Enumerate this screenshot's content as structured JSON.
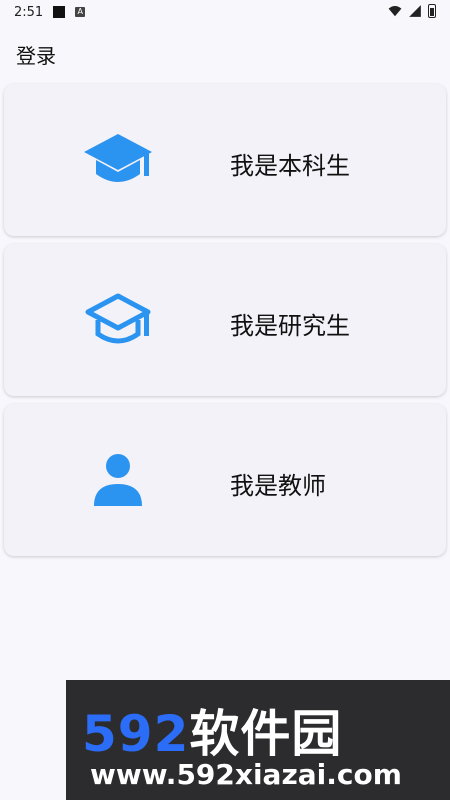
{
  "status_bar": {
    "time": "2:51",
    "a_glyph": "A"
  },
  "header": {
    "title": "登录"
  },
  "cards": [
    {
      "label": "我是本科生",
      "icon": "graduation-cap-filled-icon"
    },
    {
      "label": "我是研究生",
      "icon": "graduation-cap-outline-icon"
    },
    {
      "label": "我是教师",
      "icon": "person-icon"
    }
  ],
  "watermark": {
    "number_text": "592",
    "cn_text": "软件园",
    "url": "www.592xiazai.com"
  },
  "colors": {
    "accent": "#2b93f0",
    "card_bg": "#f2f2f8",
    "page_bg": "#f8f8fc"
  }
}
